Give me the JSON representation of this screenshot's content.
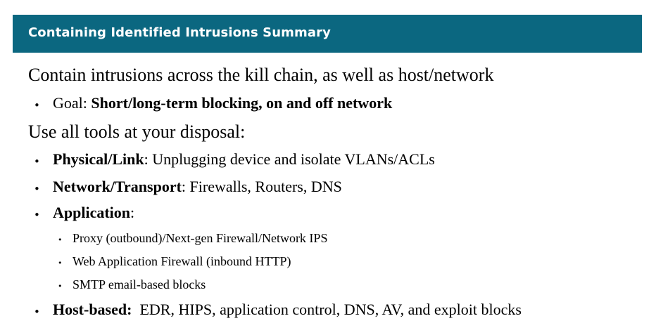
{
  "header": {
    "title": "Containing Identified Intrusions Summary"
  },
  "content": {
    "line1": "Contain intrusions across the kill chain, as well as host/network",
    "goal": {
      "label": "Goal: ",
      "text": "Short/long-term blocking, on and off network"
    },
    "line2": "Use all tools at your disposal:",
    "items": [
      {
        "bold": "Physical/Link",
        "rest": ": Unplugging device and isolate VLANs/ACLs"
      },
      {
        "bold": "Network/Transport",
        "rest": ": Firewalls, Routers, DNS"
      },
      {
        "bold": "Application",
        "rest": ":"
      }
    ],
    "sub_items": [
      "Proxy (outbound)/Next-gen Firewall/Network IPS",
      "Web Application Firewall (inbound HTTP)",
      "SMTP email-based blocks"
    ],
    "host": {
      "bold": "Host-based:",
      "rest": "  EDR, HIPS, application control, DNS, AV, and exploit blocks"
    }
  },
  "colors": {
    "header_bg": "#0b6780",
    "header_text": "#ffffff",
    "body_text": "#000000"
  }
}
